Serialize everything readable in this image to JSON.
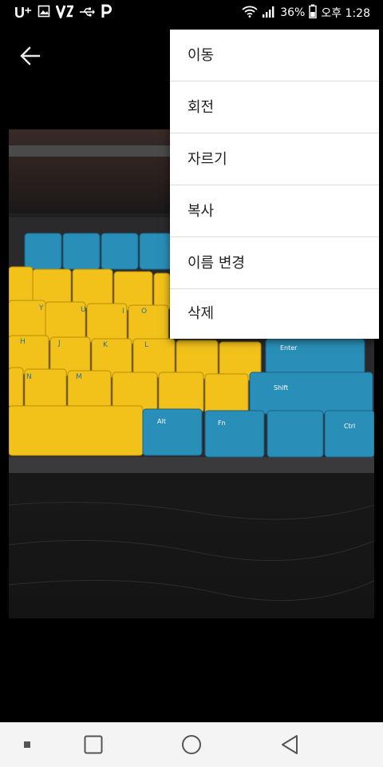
{
  "status_bar": {
    "carrier": "U⁺",
    "battery_percent": "36%",
    "time": "오후 1:28"
  },
  "app_bar": {
    "back_icon": "arrow-back-icon"
  },
  "menu": {
    "items": [
      {
        "label": "이동"
      },
      {
        "label": "회전"
      },
      {
        "label": "자르기"
      },
      {
        "label": "복사"
      },
      {
        "label": "이름 변경"
      },
      {
        "label": "삭제"
      }
    ]
  },
  "nav_bar": {
    "icons": [
      "dot-icon",
      "recents-square-icon",
      "home-circle-icon",
      "back-triangle-icon"
    ]
  },
  "colors": {
    "keycap_yellow": "#f2c21b",
    "keycap_blue": "#2a8fb8",
    "menu_bg": "#ffffff",
    "nav_bg": "#f4f4f4"
  }
}
